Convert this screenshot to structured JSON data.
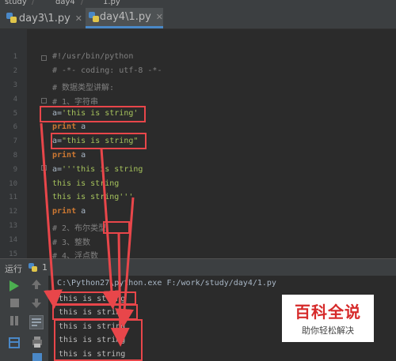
{
  "breadcrumb": [
    "study",
    "day4",
    "1.py"
  ],
  "tabs": [
    {
      "label": "day3\\1.py",
      "active": false
    },
    {
      "label": "day4\\1.py",
      "active": true
    }
  ],
  "editor": {
    "line_numbers": [
      "1",
      "2",
      "3",
      "4",
      "5",
      "6",
      "7",
      "8",
      "9",
      "10",
      "11",
      "12",
      "13",
      "14",
      "15"
    ],
    "lines": {
      "l1": "#!/usr/bin/python",
      "l2": "# -*- coding: utf-8 -*-",
      "l3": "# 数据类型讲解:",
      "l4": "# 1、字符串",
      "l5_var": "a=",
      "l5_str": "'this is string'",
      "l6_kw": "print",
      "l6_var": " a",
      "l7_var": "a=",
      "l7_str": "\"this is string\"",
      "l8_kw": "print",
      "l8_var": " a",
      "l9_var": "a=",
      "l9_str": "'''this is string",
      "l10_str": "this is string",
      "l11_str": "this is string'''",
      "l12_kw": "print",
      "l12_var": " a",
      "l13": "# 2、布尔类型",
      "l14": "# 3、整数",
      "l15": "# 4、浮点数"
    }
  },
  "run_panel": {
    "title": "运行",
    "config": "1",
    "command": "C:\\Python27\\python.exe F:/work/study/day4/1.py",
    "output": [
      "this is string",
      "this is string",
      "this is string",
      "this is string",
      "this is string"
    ]
  },
  "watermark": {
    "title": "百科全说",
    "subtitle": "助你轻松解决"
  },
  "colors": {
    "annotation": "#e8464a",
    "accent": "#4a88c7",
    "run_green": "#4caf50"
  }
}
